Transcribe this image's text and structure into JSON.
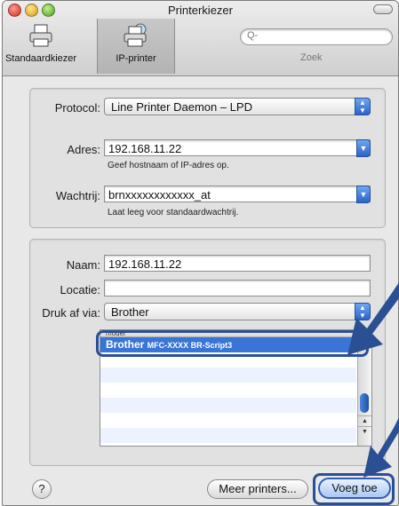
{
  "window": {
    "title": "Printerkiezer"
  },
  "toolbar": {
    "tab_default": "Standaardkiezer",
    "tab_ip": "IP-printer",
    "search_placeholder": "Q-",
    "search_label": "Zoek"
  },
  "ip_settings": {
    "protocol_label": "Protocol:",
    "protocol_value": "Line Printer Daemon – LPD",
    "address_label": "Adres:",
    "address_value": "192.168.11.22",
    "address_hint": "Geef hostnaam of IP-adres op.",
    "queue_label": "Wachtrij:",
    "queue_value": "brnxxxxxxxxxxxx_at",
    "queue_hint": "Laat leeg voor standaardwachtrij."
  },
  "printer_info": {
    "name_label": "Naam:",
    "name_value": "192.168.11.22",
    "location_label": "Locatie:",
    "location_value": "",
    "print_via_label": "Druk af via:",
    "print_via_value": "Brother",
    "list_header": "model",
    "selected_model_brand": "Brother ",
    "selected_model_name": "MFC-XXXX BR-Script3"
  },
  "footer": {
    "help_label": "?",
    "more_printers_label": "Meer printers...",
    "add_label": "Voeg toe"
  },
  "colors": {
    "accent": "#3875d7",
    "callout": "#2b4f93"
  }
}
